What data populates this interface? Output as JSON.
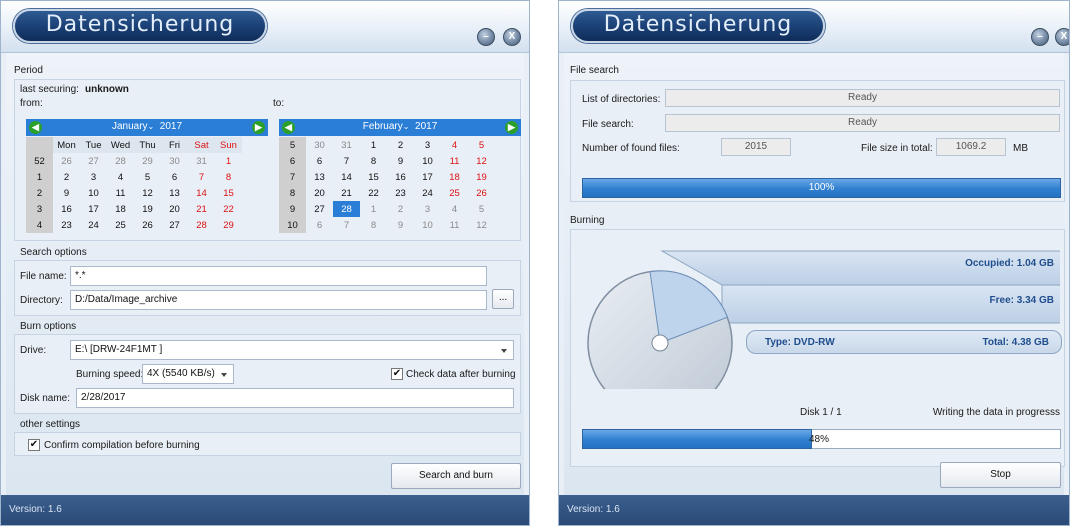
{
  "app": {
    "title": "Datensicherung",
    "version": "Version: 1.6",
    "minimize_label": "–",
    "close_label": "X"
  },
  "left": {
    "period": {
      "heading": "Period",
      "last_securing_label": "last securing:",
      "last_securing_value": "unknown",
      "from_label": "from:",
      "to_label": "to:"
    },
    "cal_from": {
      "month": "January",
      "year": "2017",
      "headers": [
        "",
        "Mon",
        "Tue",
        "Wed",
        "Thu",
        "Fri",
        "Sat",
        "Sun"
      ],
      "rows": [
        [
          "52",
          "26",
          "27",
          "28",
          "29",
          "30",
          "31",
          "1"
        ],
        [
          "1",
          "2",
          "3",
          "4",
          "5",
          "6",
          "7",
          "8"
        ],
        [
          "2",
          "9",
          "10",
          "11",
          "12",
          "13",
          "14",
          "15"
        ],
        [
          "3",
          "16",
          "17",
          "18",
          "19",
          "20",
          "21",
          "22"
        ],
        [
          "4",
          "23",
          "24",
          "25",
          "26",
          "27",
          "28",
          "29"
        ]
      ]
    },
    "cal_to": {
      "month": "February",
      "year": "2017",
      "rows": [
        [
          "5",
          "30",
          "31",
          "1",
          "2",
          "3",
          "4",
          "5"
        ],
        [
          "6",
          "6",
          "7",
          "8",
          "9",
          "10",
          "11",
          "12"
        ],
        [
          "7",
          "13",
          "14",
          "15",
          "16",
          "17",
          "18",
          "19"
        ],
        [
          "8",
          "20",
          "21",
          "22",
          "23",
          "24",
          "25",
          "26"
        ],
        [
          "9",
          "27",
          "28",
          "1",
          "2",
          "3",
          "4",
          "5"
        ],
        [
          "10",
          "6",
          "7",
          "8",
          "9",
          "10",
          "11",
          "12"
        ]
      ],
      "selected": "28"
    },
    "search_options": {
      "heading": "Search options",
      "file_name_label": "File name:",
      "file_name_value": "*.*",
      "directory_label": "Directory:",
      "directory_value": "D:/Data/Image_archive",
      "browse_label": "..."
    },
    "burn_options": {
      "heading": "Burn options",
      "drive_label": "Drive:",
      "drive_value": "E:\\ [DRW-24F1MT      ]",
      "speed_label": "Burning speed:",
      "speed_value": "4X (5540 KB/s)",
      "check_label": "Check data after burning",
      "disk_name_label": "Disk name:",
      "disk_name_value": "2/28/2017"
    },
    "other": {
      "heading": "other settings",
      "confirm_label": "Confirm compilation before burning"
    },
    "search_burn_button": "Search and burn"
  },
  "right": {
    "file_search": {
      "heading": "File search",
      "list_dirs_label": "List of directories:",
      "list_dirs_value": "Ready",
      "file_search_label": "File search:",
      "file_search_value": "Ready",
      "found_label": "Number of found files:",
      "found_value": "2015",
      "size_label": "File size in total:",
      "size_value": "1069.2",
      "size_unit": "MB",
      "progress_text": "100%",
      "progress": 1.0
    },
    "burning": {
      "heading": "Burning",
      "occupied": "Occupied: 1.04 GB",
      "free": "Free: 3.34 GB",
      "type": "Type: DVD-RW",
      "total": "Total: 4.38 GB",
      "disk_counter": "Disk 1 / 1",
      "status": "Writing the data in progresss",
      "progress_text": "48%",
      "progress": 0.48
    },
    "stop_button": "Stop"
  },
  "colors": {
    "accent": "#2b7ed6",
    "title_bar": "#1a3f74",
    "status_bar": "#2a4a77",
    "weekend": "#d11111",
    "nav_green": "#2aa02a"
  }
}
